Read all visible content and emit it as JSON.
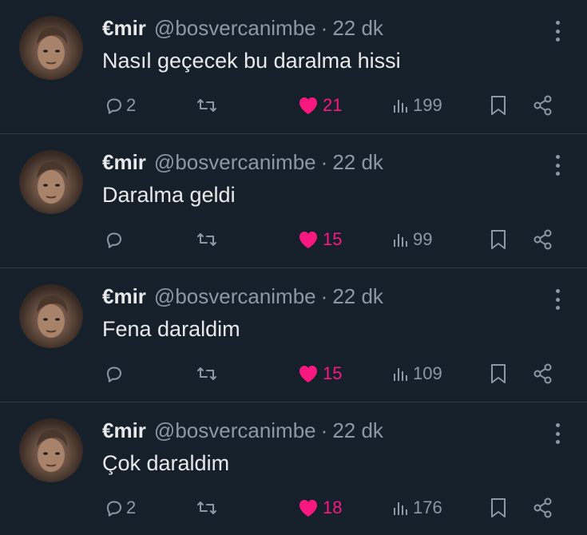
{
  "colors": {
    "background": "#15202b",
    "text": "#e7e9ea",
    "muted": "#8b98a5",
    "like": "#f91880",
    "divider": "#2f3943"
  },
  "icons": {
    "reply": "reply-icon",
    "retweet": "retweet-icon",
    "like": "heart-icon",
    "views": "views-icon",
    "bookmark": "bookmark-icon",
    "share": "share-icon",
    "more": "more-icon"
  },
  "tweets": [
    {
      "name": "€mir",
      "handle": "@bosvercanimbe",
      "separator": "·",
      "time": "22 dk",
      "text": "Nasıl geçecek bu daralma hissi",
      "replies": "2",
      "retweets": "",
      "likes": "21",
      "views": "199"
    },
    {
      "name": "€mir",
      "handle": "@bosvercanimbe",
      "separator": "·",
      "time": "22 dk",
      "text": "Daralma geldi",
      "replies": "",
      "retweets": "",
      "likes": "15",
      "views": "99"
    },
    {
      "name": "€mir",
      "handle": "@bosvercanimbe",
      "separator": "·",
      "time": "22 dk",
      "text": "Fena daraldim",
      "replies": "",
      "retweets": "",
      "likes": "15",
      "views": "109"
    },
    {
      "name": "€mir",
      "handle": "@bosvercanimbe",
      "separator": "·",
      "time": "22 dk",
      "text": "Çok daraldim",
      "replies": "2",
      "retweets": "",
      "likes": "18",
      "views": "176"
    }
  ]
}
